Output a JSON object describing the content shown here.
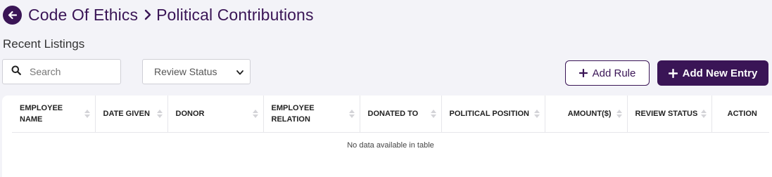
{
  "breadcrumb": {
    "parent": "Code Of Ethics",
    "current": "Political Contributions"
  },
  "subtitle": "Recent Listings",
  "search": {
    "placeholder": "Search",
    "value": ""
  },
  "review_filter": {
    "selected": "Review Status"
  },
  "buttons": {
    "add_rule": "Add Rule",
    "add_new_entry": "Add New Entry"
  },
  "table": {
    "columns": [
      {
        "line1": "EMPLOYEE",
        "line2": "NAME"
      },
      {
        "line1": "DATE GIVEN",
        "line2": ""
      },
      {
        "line1": "DONOR",
        "line2": ""
      },
      {
        "line1": "EMPLOYEE",
        "line2": "RELATION"
      },
      {
        "line1": "DONATED TO",
        "line2": ""
      },
      {
        "line1": "POLITICAL POSITION",
        "line2": ""
      },
      {
        "line1": "AMOUNT($)",
        "line2": ""
      },
      {
        "line1": "REVIEW STATUS",
        "line2": ""
      },
      {
        "line1": "ACTION",
        "line2": ""
      }
    ],
    "empty_message": "No data available in table"
  },
  "colors": {
    "brand": "#3a1556",
    "background": "#f3f3f8"
  },
  "icons": {
    "back": "arrow-left-circle-icon",
    "separator": "chevron-right-icon",
    "search": "search-icon",
    "plus": "plus-icon",
    "sort": "sort-arrows-icon"
  }
}
